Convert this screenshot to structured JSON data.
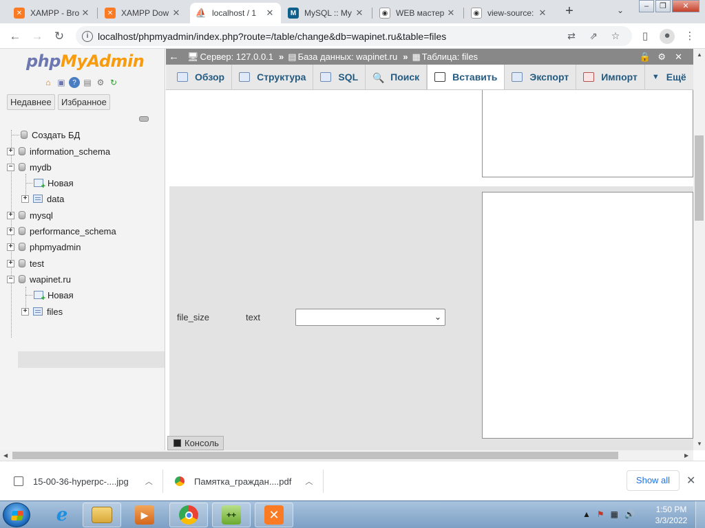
{
  "browser": {
    "tabs": [
      {
        "title": "XAMPP - Bro",
        "favicon": "xampp-icon",
        "active": false
      },
      {
        "title": "XAMPP Dow",
        "favicon": "xampp-icon",
        "active": false
      },
      {
        "title": "localhost / 1",
        "favicon": "phpmyadmin-icon",
        "active": true
      },
      {
        "title": "MySQL :: My",
        "favicon": "mysql-icon",
        "active": false
      },
      {
        "title": "WEB мастер",
        "favicon": "eye-icon",
        "active": false
      },
      {
        "title": "view-source:",
        "favicon": "eye-icon",
        "active": false
      }
    ],
    "new_tab_label": "+",
    "tab_search_label": "⌄",
    "url": "localhost/phpmyadmin/index.php?route=/table/change&db=wapinet.ru&table=files",
    "window_controls": [
      "–",
      "❐",
      "✕"
    ]
  },
  "pma": {
    "logo_php": "php",
    "logo_myadmin": "MyAdmin",
    "nav_tabs": [
      "Недавнее",
      "Избранное"
    ],
    "tree": [
      {
        "label": "Создать БД",
        "type": "new",
        "level": 0
      },
      {
        "label": "information_schema",
        "type": "db",
        "expander": "+",
        "level": 0
      },
      {
        "label": "mydb",
        "type": "db",
        "expander": "−",
        "level": 0
      },
      {
        "label": "Новая",
        "type": "new",
        "level": 1
      },
      {
        "label": "data",
        "type": "table",
        "expander": "+",
        "level": 1
      },
      {
        "label": "mysql",
        "type": "db",
        "expander": "+",
        "level": 0
      },
      {
        "label": "performance_schema",
        "type": "db",
        "expander": "+",
        "level": 0
      },
      {
        "label": "phpmyadmin",
        "type": "db",
        "expander": "+",
        "level": 0
      },
      {
        "label": "test",
        "type": "db",
        "expander": "+",
        "level": 0
      },
      {
        "label": "wapinet.ru",
        "type": "db",
        "expander": "−",
        "level": 0
      },
      {
        "label": "Новая",
        "type": "new",
        "level": 1
      },
      {
        "label": "files",
        "type": "table",
        "expander": "+",
        "level": 1,
        "selected": true
      }
    ],
    "breadcrumb": {
      "server": "Сервер: 127.0.0.1",
      "database": "База данных: wapinet.ru",
      "table": "Таблица: files",
      "separator": "»",
      "back": "←"
    },
    "menu_tabs": [
      {
        "label": "Обзор",
        "active": false
      },
      {
        "label": "Структура",
        "active": false
      },
      {
        "label": "SQL",
        "active": false
      },
      {
        "label": "Поиск",
        "active": false
      },
      {
        "label": "Вставить",
        "active": true
      },
      {
        "label": "Экспорт",
        "active": false
      },
      {
        "label": "Импорт",
        "active": false
      },
      {
        "label": "Ещё",
        "active": false
      }
    ],
    "field_row": {
      "name": "file_size",
      "type": "text",
      "function_value": ""
    },
    "console_label": "Консоль"
  },
  "downloads": {
    "items": [
      {
        "name": "15-00-36-hyperpc-....jpg",
        "icon": "image-file-icon"
      },
      {
        "name": "Памятка_граждан....pdf",
        "icon": "chrome-icon"
      }
    ],
    "show_all": "Show all",
    "close": "✕"
  },
  "taskbar": {
    "time": "1:50 PM",
    "date": "3/3/2022"
  }
}
